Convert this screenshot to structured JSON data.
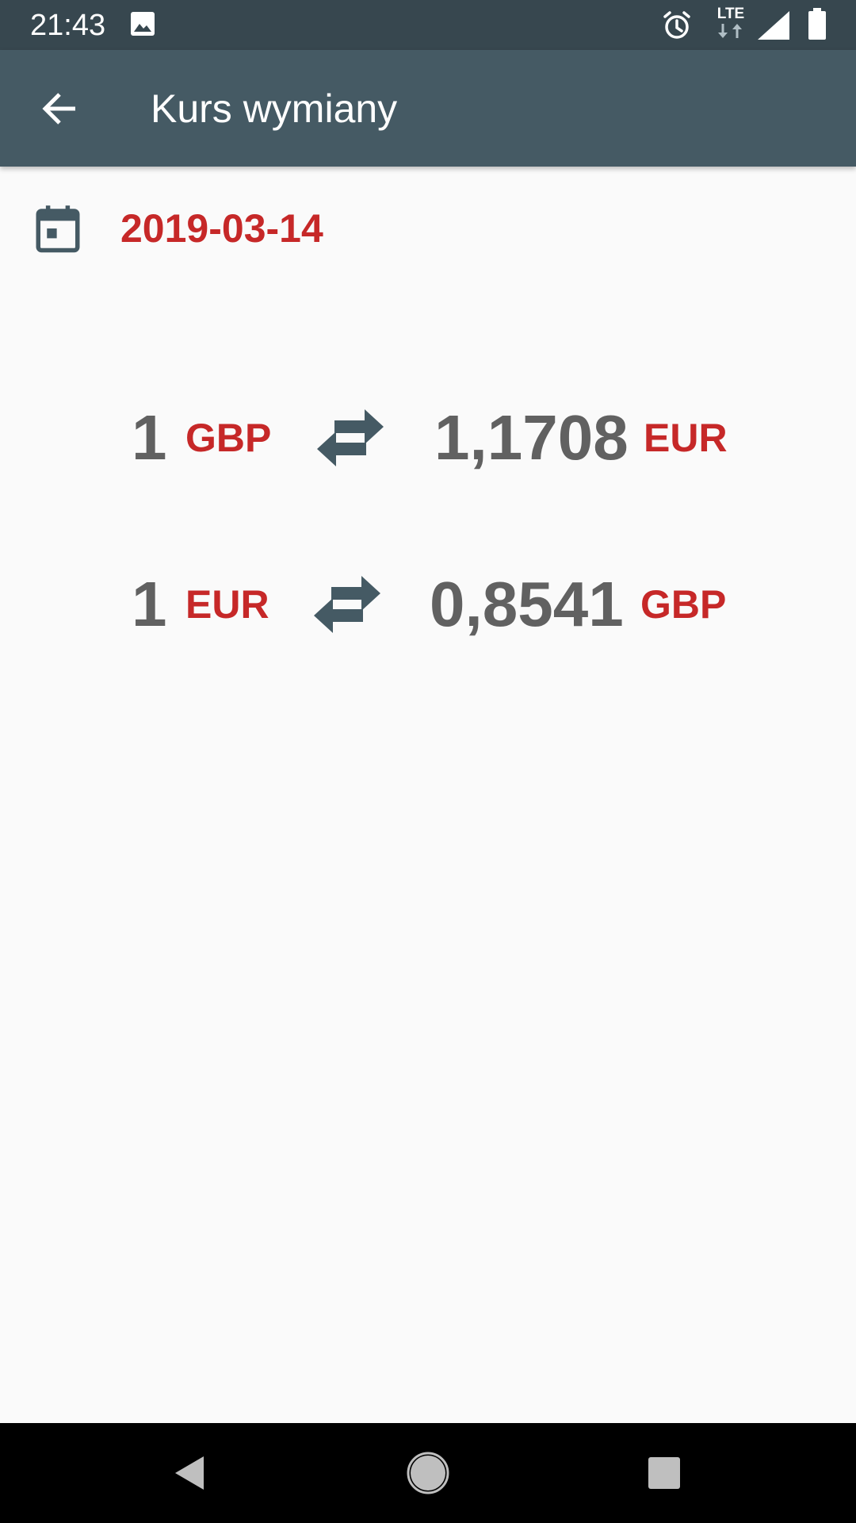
{
  "status_bar": {
    "time": "21:43",
    "network_label": "LTE",
    "icons": [
      "image-icon",
      "alarm-icon",
      "lte-data-icon",
      "signal-icon",
      "battery-icon"
    ]
  },
  "app_bar": {
    "title": "Kurs wymiany",
    "back_icon": "arrow-back-icon"
  },
  "date": {
    "value": "2019-03-14",
    "icon": "calendar-icon"
  },
  "rates": [
    {
      "from_amount": "1",
      "from_currency": "GBP",
      "to_amount": "1,1708",
      "to_currency": "EUR"
    },
    {
      "from_amount": "1",
      "from_currency": "EUR",
      "to_amount": "0,8541",
      "to_currency": "GBP"
    }
  ],
  "nav_bar": {
    "icons": [
      "nav-back-icon",
      "nav-home-icon",
      "nav-recents-icon"
    ]
  },
  "colors": {
    "status_bar": "#37474f",
    "app_bar": "#455a64",
    "accent": "#c62828",
    "amount_text": "#616161",
    "swap_icon": "#455a64",
    "background": "#fafafa"
  }
}
